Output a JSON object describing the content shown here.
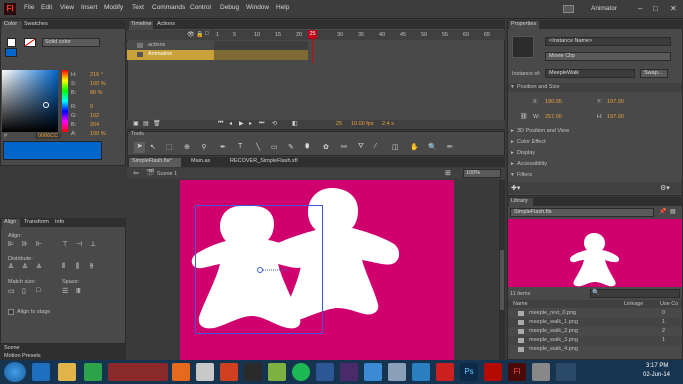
{
  "app": {
    "logo": "Fl",
    "menus": [
      "File",
      "Edit",
      "View",
      "Insert",
      "Modify",
      "Text",
      "Commands",
      "Control",
      "Debug",
      "Window",
      "Help"
    ],
    "workspace": "Animator",
    "window_buttons": [
      "–",
      "□",
      "✕"
    ]
  },
  "color_panel": {
    "tabs": [
      "Color",
      "Swatches"
    ],
    "fill_type": "Solid color",
    "h_label": "H:",
    "h_value": "216 °",
    "s_label": "S:",
    "s_value": "100 %",
    "b_label": "B:",
    "b_value": "80 %",
    "r_label": "R:",
    "r_value": "0",
    "g_label": "G:",
    "g_value": "102",
    "bl_label": "B:",
    "bl_value": "204",
    "a_label": "A:",
    "a_value": "100 %",
    "hex": "0066CC",
    "swatch_color": "#0066cc"
  },
  "timeline": {
    "tabs": [
      "Timeline",
      "Actions"
    ],
    "layers": [
      {
        "name": "actions"
      },
      {
        "name": "Animation"
      }
    ],
    "frame_numbers": [
      "1",
      "5",
      "10",
      "15",
      "20",
      "25",
      "30",
      "35",
      "40",
      "45",
      "50",
      "55",
      "60",
      "65",
      "70",
      "75",
      "80"
    ],
    "current_frame": "25",
    "fps": "10.00 fps",
    "time": "2.4 s"
  },
  "tools": {
    "title": "Tools"
  },
  "documents": {
    "tabs": [
      "SimpleFlash.fla*",
      "Main.as",
      "RECOVER_SimpleFlash.xfl"
    ],
    "scene": "Scene 1",
    "zoom": "100%"
  },
  "align_panel": {
    "tabs": [
      "Align",
      "Transform",
      "Info"
    ],
    "align_label": "Align:",
    "distribute_label": "Distribute:",
    "match_size_label": "Match size:",
    "space_label": "Space:",
    "align_to_stage": "Align to stage"
  },
  "bottom_panels": [
    "Scene",
    "Motion Presets"
  ],
  "properties": {
    "tabs": [
      "Properties"
    ],
    "instance_name_placeholder": "<Instance Name>",
    "symbol_type": "Movie Clip",
    "instance_of_label": "Instance of:",
    "instance_of": "MeepleWalk",
    "swap": "Swap...",
    "sections": {
      "position_size": "Position and Size",
      "position_3d": "3D Position and View",
      "color_effect": "Color Effect",
      "display": "Display",
      "accessibility": "Accessibility",
      "filters": "Filters"
    },
    "x_label": "X:",
    "x_value": "190.95",
    "y_label": "Y:",
    "y_value": "197.00",
    "w_label": "W:",
    "w_value": "257.00",
    "h_label": "H:",
    "h_value": "197.00"
  },
  "library": {
    "tabs": [
      "Library"
    ],
    "doc": "SimpleFlash.fla",
    "item_count": "11 items",
    "columns": [
      "Name",
      "Linkage",
      "Use Co"
    ],
    "items": [
      {
        "name": "meeple_rest_0.png",
        "count": "0"
      },
      {
        "name": "meeple_walk_1.png",
        "count": "1"
      },
      {
        "name": "meeple_walk_2.png",
        "count": "2"
      },
      {
        "name": "meeple_walk_3.png",
        "count": "1"
      },
      {
        "name": "meeple_walk_4.png",
        "count": ""
      }
    ]
  },
  "stage": {
    "bg_color": "#d0006f"
  },
  "taskbar": {
    "time": "3:17 PM",
    "date": "02-Jun-14"
  }
}
